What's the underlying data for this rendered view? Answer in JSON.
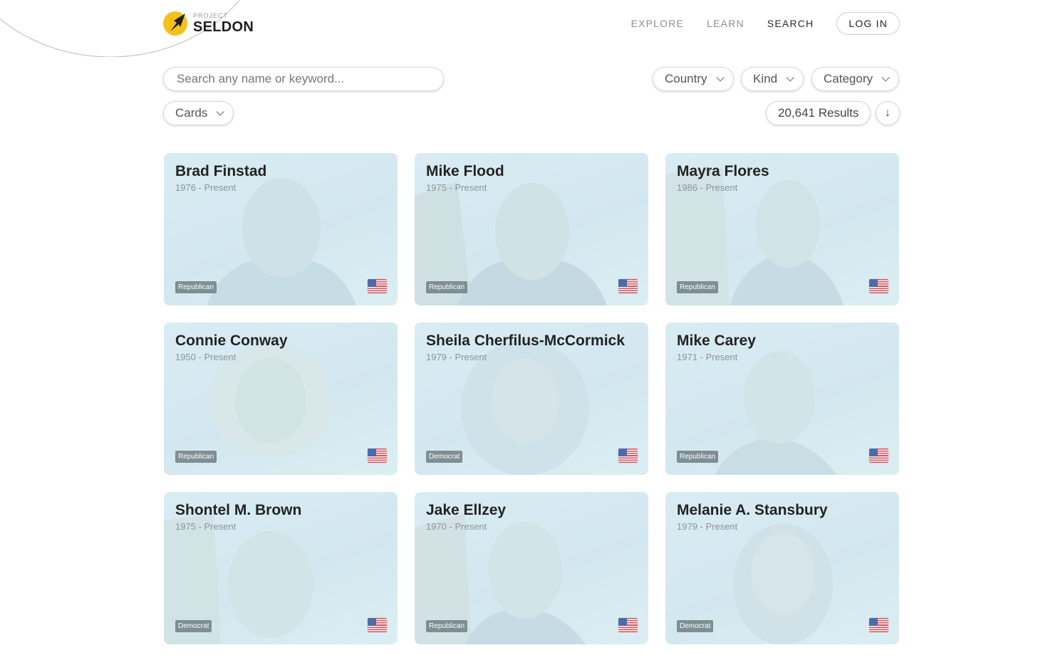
{
  "header": {
    "logo_small": "PROJECT",
    "logo_big": "SELDON",
    "nav": [
      {
        "label": "EXPLORE",
        "active": false
      },
      {
        "label": "LEARN",
        "active": false
      },
      {
        "label": "SEARCH",
        "active": true
      }
    ],
    "login_label": "LOG IN"
  },
  "search": {
    "placeholder": "Search any name or keyword...",
    "value": ""
  },
  "filters": {
    "country": "Country",
    "kind": "Kind",
    "category": "Category"
  },
  "view_mode": "Cards",
  "results_label": "20,641 Results",
  "sort_icon": "↓",
  "colors": {
    "accent": "#f2c21a",
    "card_bg": "#d6eaf2",
    "badge": "#7d8f93"
  },
  "cards": [
    {
      "name": "Brad Finstad",
      "years": "1976 - Present",
      "party": "Republican",
      "flag": "us-flag-icon"
    },
    {
      "name": "Mike Flood",
      "years": "1975 - Present",
      "party": "Republican",
      "flag": "us-flag-icon"
    },
    {
      "name": "Mayra Flores",
      "years": "1986 - Present",
      "party": "Republican",
      "flag": "us-flag-icon"
    },
    {
      "name": "Connie Conway",
      "years": "1950 - Present",
      "party": "Republican",
      "flag": "us-flag-icon"
    },
    {
      "name": "Sheila Cherfilus-McCormick",
      "years": "1979 - Present",
      "party": "Democrat",
      "flag": "us-flag-icon"
    },
    {
      "name": "Mike Carey",
      "years": "1971 - Present",
      "party": "Republican",
      "flag": "us-flag-icon"
    },
    {
      "name": "Shontel M. Brown",
      "years": "1975 - Present",
      "party": "Democrat",
      "flag": "us-flag-icon"
    },
    {
      "name": "Jake Ellzey",
      "years": "1970 - Present",
      "party": "Republican",
      "flag": "us-flag-icon"
    },
    {
      "name": "Melanie A. Stansbury",
      "years": "1979 - Present",
      "party": "Democrat",
      "flag": "us-flag-icon"
    }
  ]
}
